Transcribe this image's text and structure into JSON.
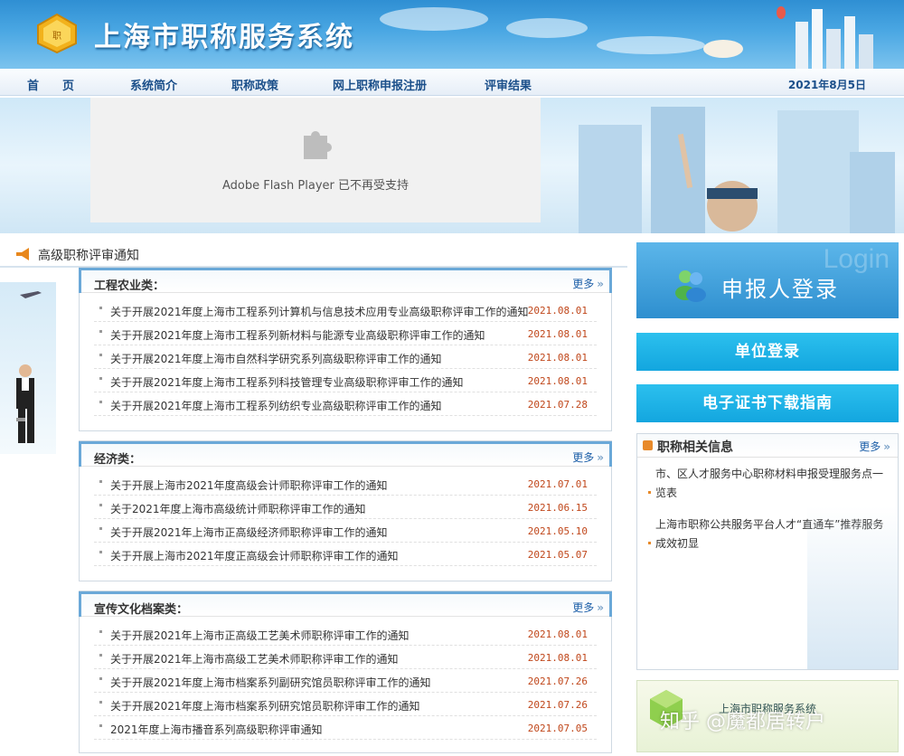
{
  "header": {
    "title": "上海市职称服务系统"
  },
  "nav": {
    "items": [
      "首　　页",
      "系统简介",
      "职称政策",
      "网上职称申报注册",
      "评审结果"
    ],
    "date": "2021年8月5日"
  },
  "banner": {
    "flash_message": "Adobe Flash Player 已不再受支持"
  },
  "section": {
    "title": "高级职称评审通知"
  },
  "boxes": [
    {
      "title": "工程农业类：",
      "more": "更多",
      "items": [
        {
          "title": "关于开展2021年度上海市工程系列计算机与信息技术应用专业高级职称评审工作的通知",
          "date": "2021.08.01"
        },
        {
          "title": "关于开展2021年度上海市工程系列新材料与能源专业高级职称评审工作的通知",
          "date": "2021.08.01"
        },
        {
          "title": "关于开展2021年度上海市自然科学研究系列高级职称评审工作的通知",
          "date": "2021.08.01"
        },
        {
          "title": "关于开展2021年度上海市工程系列科技管理专业高级职称评审工作的通知",
          "date": "2021.08.01"
        },
        {
          "title": "关于开展2021年度上海市工程系列纺织专业高级职称评审工作的通知",
          "date": "2021.07.28"
        }
      ]
    },
    {
      "title": "经济类：",
      "more": "更多",
      "items": [
        {
          "title": "关于开展上海市2021年度高级会计师职称评审工作的通知",
          "date": "2021.07.01"
        },
        {
          "title": "关于2021年度上海市高级统计师职称评审工作的通知",
          "date": "2021.06.15"
        },
        {
          "title": "关于开展2021年上海市正高级经济师职称评审工作的通知",
          "date": "2021.05.10"
        },
        {
          "title": "关于开展上海市2021年度正高级会计师职称评审工作的通知",
          "date": "2021.05.07"
        }
      ]
    },
    {
      "title": "宣传文化档案类：",
      "more": "更多",
      "items": [
        {
          "title": "关于开展2021年上海市正高级工艺美术师职称评审工作的通知",
          "date": "2021.08.01"
        },
        {
          "title": "关于开展2021年上海市高级工艺美术师职称评审工作的通知",
          "date": "2021.08.01"
        },
        {
          "title": "关于开展2021年度上海市档案系列副研究馆员职称评审工作的通知",
          "date": "2021.07.26"
        },
        {
          "title": "关于开展2021年度上海市档案系列研究馆员职称评审工作的通知",
          "date": "2021.07.26"
        },
        {
          "title": "2021年度上海市播音系列高级职称评审通知",
          "date": "2021.07.05"
        }
      ]
    }
  ],
  "right": {
    "login_bg_word": "Login",
    "login_label": "申报人登录",
    "unit_login": "单位登录",
    "cert_guide": "电子证书下载指南",
    "info": {
      "title": "职称相关信息",
      "more": "更多",
      "items": [
        "市、区人才服务中心职称材料申报受理服务点一览表",
        "上海市职称公共服务平台人才“直通车”推荐服务成效初显"
      ]
    },
    "footer_banner_text": "上海市职称服务系统"
  },
  "watermark": "知乎 @魔都居转户",
  "colors": {
    "accent": "#2e8fcf",
    "cyan_button": "#13a6df",
    "date": "#c0471b",
    "link": "#1d5fa8"
  }
}
